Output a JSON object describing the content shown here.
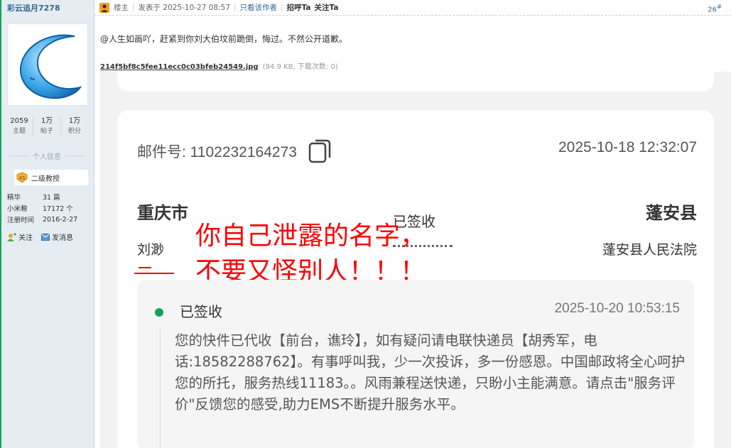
{
  "user": {
    "name": "彩云追月7278",
    "stats": [
      {
        "num": "2059",
        "label": "主题"
      },
      {
        "num": "1万",
        "label": "帖子"
      },
      {
        "num": "1万",
        "label": "积分"
      }
    ],
    "section_title": "个人信息",
    "rank_level": "45",
    "rank": "二级教授",
    "info": [
      {
        "k": "精华",
        "v": "31 篇"
      },
      {
        "k": "小米粮",
        "v": "17172 个"
      },
      {
        "k": "注册时间",
        "v": "2016-2-27"
      }
    ],
    "follow_label": "关注",
    "message_label": "发消息"
  },
  "post": {
    "author_tag": "楼主",
    "posted_at": "发表于 2025-10-27 08:57",
    "only_author": "只看该作者",
    "greet": "招呼Ta",
    "follow": "关注Ta",
    "floor": "26",
    "text": "@人生如画吖，赶紧到你刘大伯坟前跪倒，悔过。不然公开道歉。",
    "attachment": {
      "name": "214f5bf8c5fee11ecc0c03bfeb24549.jpg",
      "meta": "(94.9 KB, 下载次数: 0)"
    }
  },
  "screenshot": {
    "mail_no": "邮件号: 1102232164273",
    "mail_time": "2025-10-18 12:32:07",
    "from_city": "重庆市",
    "to_city": "蓬安县",
    "status_mid": "已签收",
    "from_name": "刘渺",
    "to_name": "蓬安县人民法院",
    "overlay_line1": "你自己泄露的名字，",
    "overlay_line2": "不要又怪别人！！！",
    "track_status": "已签收",
    "track_time": "2025-10-20 10:53:15",
    "track_desc": "您的快件已代收【前台，谯玲】，如有疑问请电联快递员【胡秀军，电话:18582288762】。有事呼叫我，少一次投诉，多一份感恩。中国邮政将全心呵护您的所托，服务热线11183。。风雨兼程送快递，只盼小主能满意。请点击\"服务评价\"反馈您的感受,助力EMS不断提升服务水平。"
  },
  "colors": {
    "link": "#336699",
    "overlay_red": "#ff0000",
    "status_green": "#11a35a",
    "sidebar_bg": "#e5edf2"
  }
}
